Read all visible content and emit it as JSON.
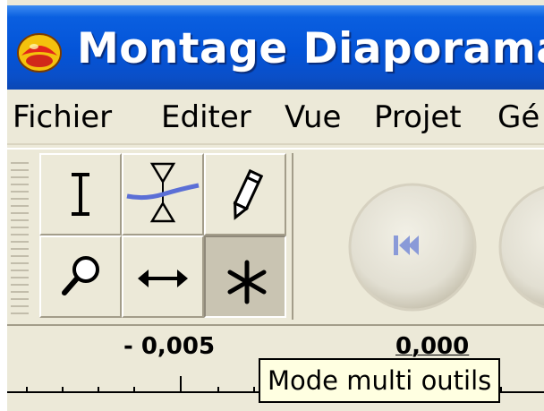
{
  "window": {
    "title": "Montage Diaporama",
    "app_icon": "app-logo-icon"
  },
  "menu": {
    "items": [
      {
        "label": "Fichier"
      },
      {
        "label": "Editer"
      },
      {
        "label": "Vue"
      },
      {
        "label": "Projet"
      },
      {
        "label": "Gé"
      }
    ]
  },
  "tools": {
    "items": [
      {
        "name": "selection-tool",
        "icon": "i-beam-icon",
        "active": false
      },
      {
        "name": "envelope-tool",
        "icon": "envelope-icon",
        "active": false
      },
      {
        "name": "draw-tool",
        "icon": "pencil-icon",
        "active": false
      },
      {
        "name": "zoom-tool",
        "icon": "magnifier-icon",
        "active": false
      },
      {
        "name": "timeshift-tool",
        "icon": "double-arrow-icon",
        "active": false
      },
      {
        "name": "multi-tool",
        "icon": "asterisk-icon",
        "active": true
      }
    ]
  },
  "transport": {
    "items": [
      {
        "icon": "skip-to-start-icon"
      }
    ]
  },
  "ruler": {
    "labels": [
      "- 0,005",
      "0,000"
    ]
  },
  "tooltip": {
    "text": "Mode multi outils"
  },
  "colors": {
    "titlebar": "#0454d8",
    "face": "#ece9d8",
    "tooltip_bg": "#ffffe1",
    "envelope_line": "#5b6fd6",
    "transport_arrow": "#8a9ad8"
  }
}
